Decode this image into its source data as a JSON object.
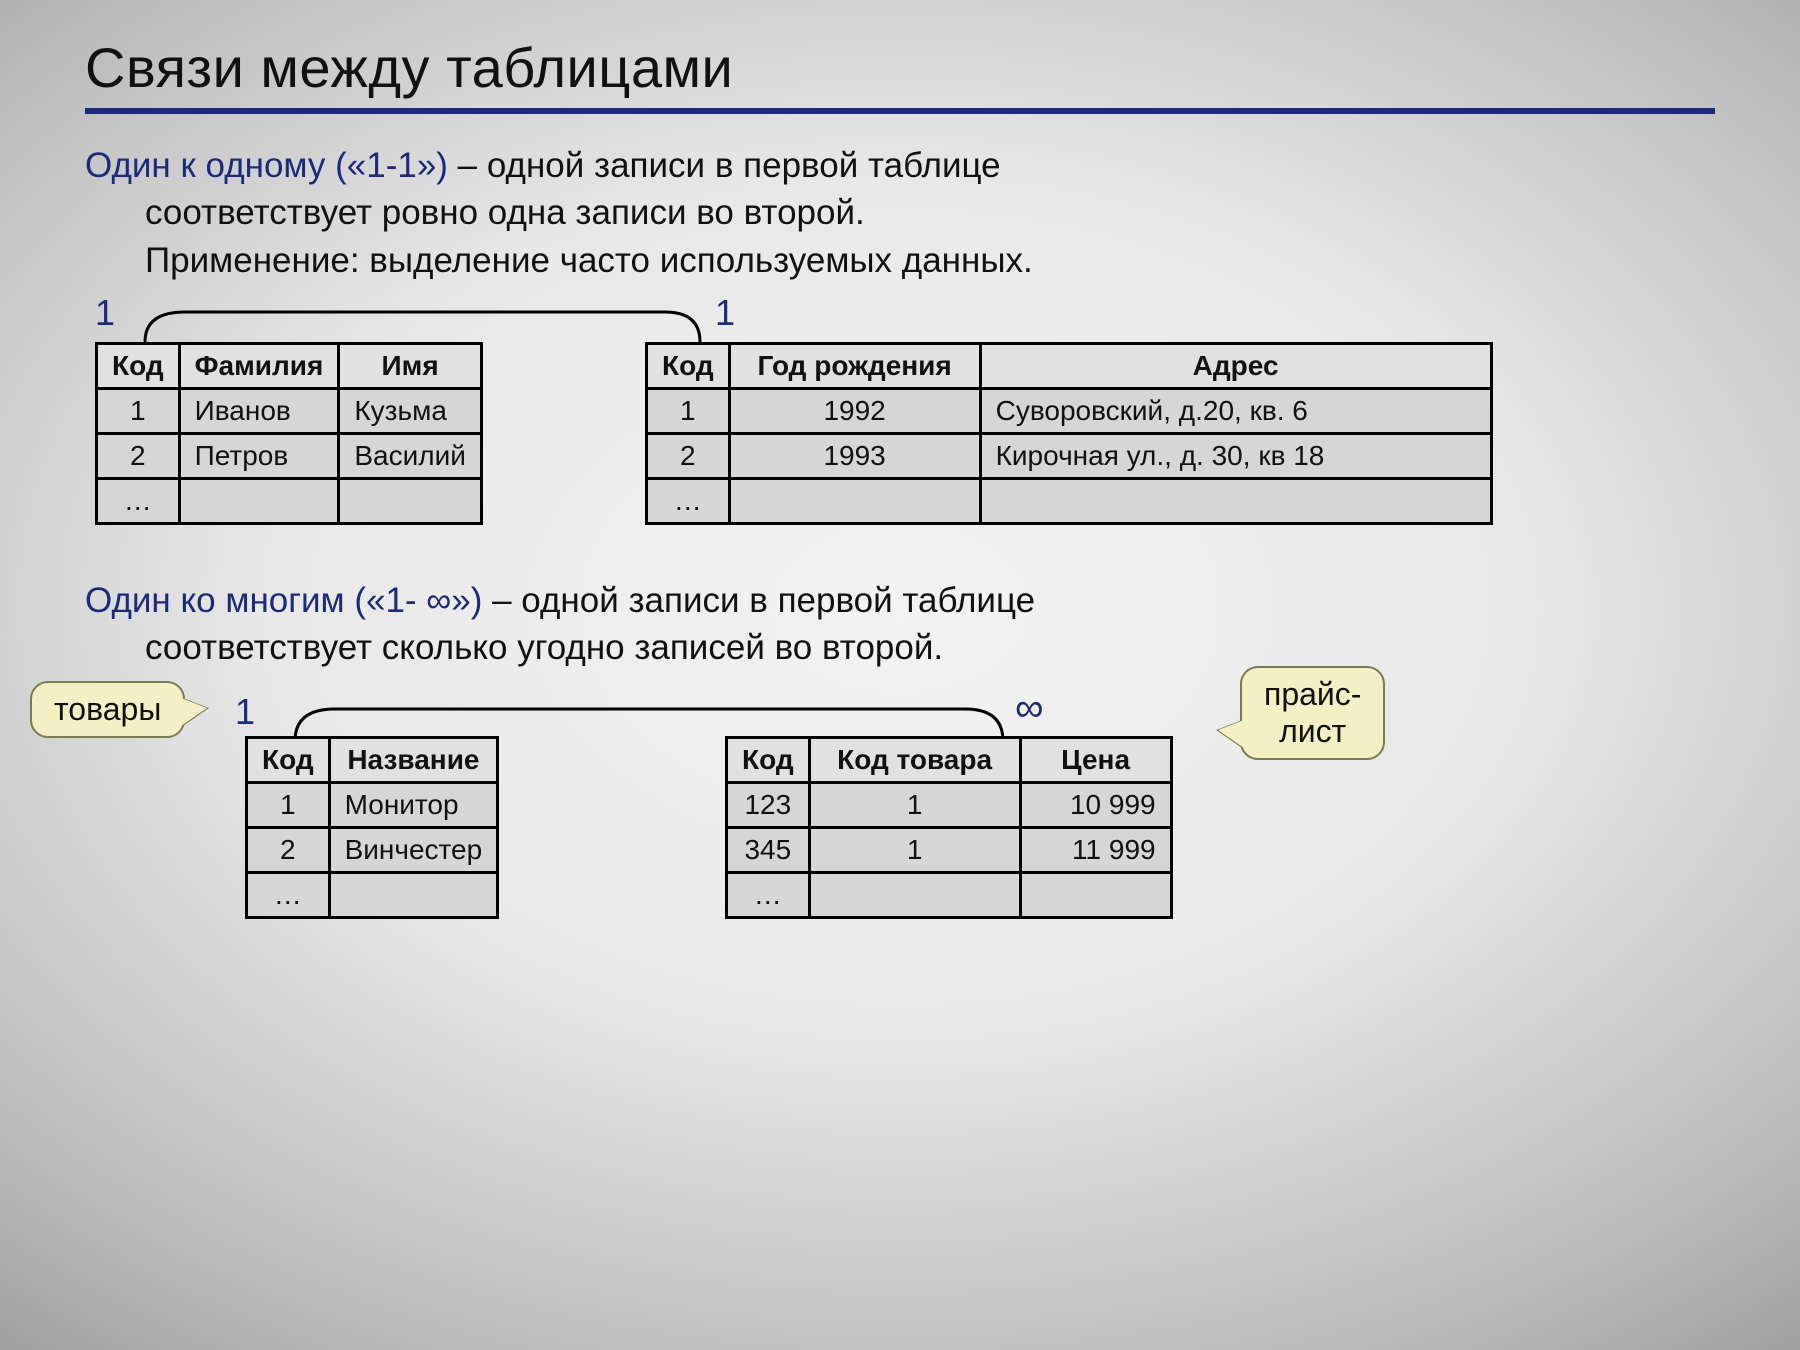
{
  "title": "Связи между таблицами",
  "section1": {
    "lead": "Один к одному («1-1»)",
    "rest": " – одной записи в первой таблице",
    "line2": "соответствует ровно одна записи во второй.",
    "line3": "Применение: выделение часто используемых данных.",
    "left_label": "1",
    "right_label": "1",
    "tableA": {
      "headers": [
        "Код",
        "Фамилия",
        "Имя"
      ],
      "rows": [
        [
          "1",
          "Иванов",
          "Кузьма"
        ],
        [
          "2",
          "Петров",
          "Василий"
        ],
        [
          "…",
          "",
          ""
        ]
      ]
    },
    "tableB": {
      "headers": [
        "Код",
        "Год рождения",
        "Адрес"
      ],
      "rows": [
        [
          "1",
          "1992",
          "Суворовский, д.20, кв. 6"
        ],
        [
          "2",
          "1993",
          "Кирочная ул., д. 30, кв 18"
        ],
        [
          "…",
          "",
          ""
        ]
      ]
    }
  },
  "section2": {
    "lead": "Один ко многим («1- ∞»)",
    "rest": " – одной записи в первой таблице",
    "line2": "соответствует сколько угодно записей во второй.",
    "left_label": "1",
    "right_label": "∞",
    "callout_left": "товары",
    "callout_right": "прайс-\nлист",
    "tableA": {
      "headers": [
        "Код",
        "Название"
      ],
      "rows": [
        [
          "1",
          "Монитор"
        ],
        [
          "2",
          "Винчестер"
        ],
        [
          "…",
          ""
        ]
      ]
    },
    "tableB": {
      "headers": [
        "Код",
        "Код товара",
        "Цена"
      ],
      "rows": [
        [
          "123",
          "1",
          "10 999"
        ],
        [
          "345",
          "1",
          "11 999"
        ],
        [
          "…",
          "",
          ""
        ]
      ]
    }
  }
}
